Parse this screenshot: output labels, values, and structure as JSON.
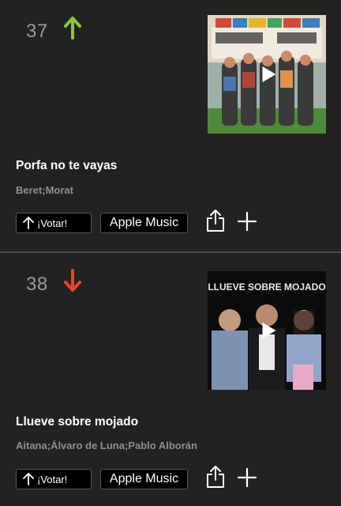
{
  "colors": {
    "background": "#222222",
    "up": "#8dc63f",
    "down": "#e8452c",
    "artist": "#8e8e8e",
    "rank": "#9a9a9a"
  },
  "songs": [
    {
      "rank": "37",
      "trend": "up",
      "title": "Porfa no te vayas",
      "artist": "Beret;Morat",
      "vote_label": "¡Votar!",
      "apple_label": "Apple Music",
      "cover_icon": "album-cover-image"
    },
    {
      "rank": "38",
      "trend": "down",
      "title": "Llueve sobre mojado",
      "artist": "Aitana;Álvaro de Luna;Pablo Alborán",
      "vote_label": "¡Votar!",
      "apple_label": "Apple Music",
      "cover_icon": "album-cover-image",
      "cover_text": "LLUEVE SOBRE MOJADO"
    }
  ],
  "icons": {
    "play": "play-icon",
    "share": "share-icon",
    "add": "plus-icon",
    "vote": "arrow-up-icon"
  }
}
